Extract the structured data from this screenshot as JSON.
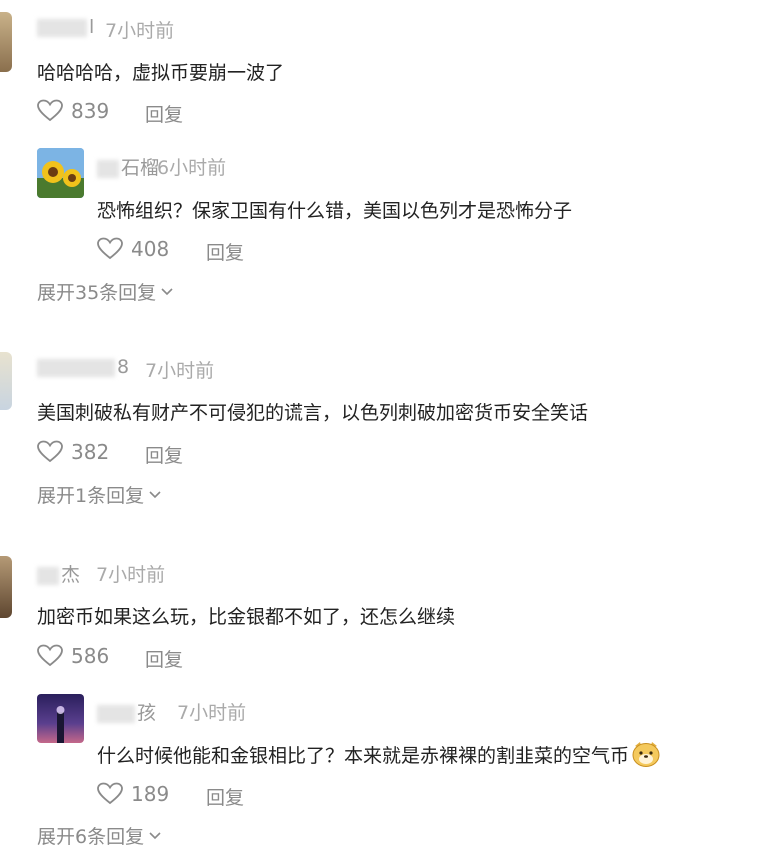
{
  "comments": [
    {
      "user": "l",
      "time": "7小时前",
      "text": "哈哈哈哈，虚拟币要崩一波了",
      "likes": "839",
      "reply_label": "回复",
      "replies": [
        {
          "user": "石榴",
          "time": "6小时前",
          "text": "恐怖组织？保家卫国有什么错，美国以色列才是恐怖分子",
          "likes": "408",
          "reply_label": "回复"
        }
      ],
      "expand_label": "展开35条回复"
    },
    {
      "user": "8",
      "time": "7小时前",
      "text": "美国刺破私有财产不可侵犯的谎言，以色列刺破加密货币安全笑话",
      "likes": "382",
      "reply_label": "回复",
      "expand_label": "展开1条回复"
    },
    {
      "user": "杰",
      "time": "7小时前",
      "text": "加密币如果这么玩，比金银都不如了，还怎么继续",
      "likes": "586",
      "reply_label": "回复",
      "replies": [
        {
          "user": "孩",
          "time": "7小时前",
          "text": "什么时候他能和金银相比了？本来就是赤裸裸的割韭菜的空气币",
          "likes": "189",
          "reply_label": "回复"
        }
      ],
      "expand_label": "展开6条回复"
    }
  ]
}
